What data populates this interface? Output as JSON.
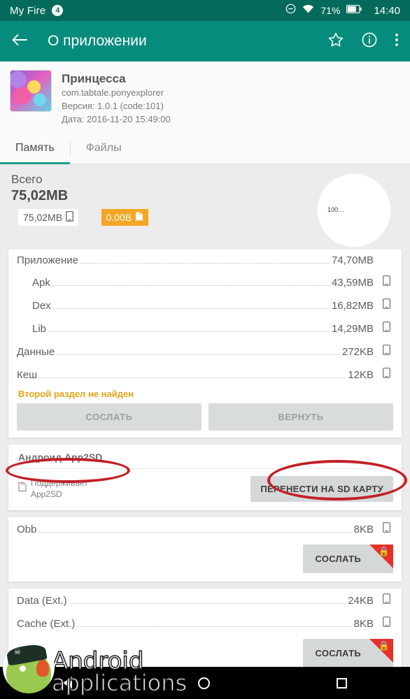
{
  "statusbar": {
    "title": "My Fire",
    "badge": "4",
    "dnd_icon": "minus-circle-icon",
    "wifi_icon": "wifi-icon",
    "battery_percent": "71%",
    "battery_icon": "battery-icon",
    "time": "14:40"
  },
  "appbar": {
    "back_icon": "back-arrow-icon",
    "title": "О приложении",
    "star_icon": "star-outline-icon",
    "info_icon": "info-circle-icon",
    "overflow_icon": "overflow-menu-icon"
  },
  "app_header": {
    "icon": "app-icon-princess",
    "name": "Принцесса",
    "package": "com.tabtale.ponyexplorer",
    "version": "Версия: 1.0.1 (code:101)",
    "date": "Дата: 2016-11-20 15:49:00"
  },
  "tabs": [
    {
      "label": "Память",
      "active": true
    },
    {
      "label": "Файлы",
      "active": false
    }
  ],
  "summary": {
    "total_label": "Всего",
    "total_value": "75,02MB",
    "internal_chip": "75,02MB",
    "internal_icon": "phone-icon",
    "sd_chip": "0.00B",
    "sd_icon": "sdcard-icon",
    "pie_label": "100…"
  },
  "storage_card": {
    "rows": [
      {
        "name": "Приложение",
        "value": "74,70MB",
        "indent": false,
        "location_icon": ""
      },
      {
        "name": "Apk",
        "value": "43,59MB",
        "indent": true,
        "location_icon": "phone-icon"
      },
      {
        "name": "Dex",
        "value": "16,82MB",
        "indent": true,
        "location_icon": "phone-icon"
      },
      {
        "name": "Lib",
        "value": "14,29MB",
        "indent": true,
        "location_icon": "phone-icon"
      },
      {
        "name": "Данные",
        "value": "272KB",
        "indent": false,
        "location_icon": "phone-icon"
      },
      {
        "name": "Кеш",
        "value": "12KB",
        "indent": false,
        "location_icon": "phone-icon"
      }
    ],
    "warning": "Второй раздел не найден",
    "link_button": "СОСЛАТЬ",
    "restore_button": "ВЕРНУТЬ"
  },
  "app2sd_card": {
    "title": "Андроид App2SD",
    "support_icon": "sdcard-icon",
    "support_line1": "Поддерживает",
    "support_line2": "App2SD",
    "move_button": "ПЕРЕНЕСТИ НА SD КАРТУ"
  },
  "obb_card": {
    "rows": [
      {
        "name": "Obb",
        "value": "8KB",
        "location_icon": "phone-icon"
      }
    ],
    "link_button": "СОСЛАТЬ",
    "lock_icon": "lock-icon"
  },
  "ext_card": {
    "rows": [
      {
        "name": "Data (Ext.)",
        "value": "24KB",
        "location_icon": "phone-icon"
      },
      {
        "name": "Cache (Ext.)",
        "value": "8KB",
        "location_icon": "phone-icon"
      }
    ],
    "link_button": "СОСЛАТЬ",
    "lock_icon": "lock-icon"
  },
  "annotations": [
    {
      "name": "red-ellipse-app2sd",
      "target": "Андроид App2SD"
    },
    {
      "name": "red-ellipse-move-sd",
      "target": "ПЕРЕНЕСТИ НА SD КАРТУ"
    }
  ],
  "watermark": {
    "line1": "Android",
    "line2": "applications",
    "mascot_icon": "android-pirate-mascot-icon"
  },
  "navbar": {
    "back_icon": "nav-back-icon",
    "home_icon": "nav-home-icon",
    "recents_icon": "nav-recents-icon"
  },
  "colors": {
    "statusbar": "#046A5C",
    "appbar": "#068C7C",
    "tab_indicator": "#1aa08d",
    "warning": "#e8a317",
    "sd_chip": "#f5a623",
    "annotation": "#c22026",
    "lock_badge": "#e53228"
  }
}
